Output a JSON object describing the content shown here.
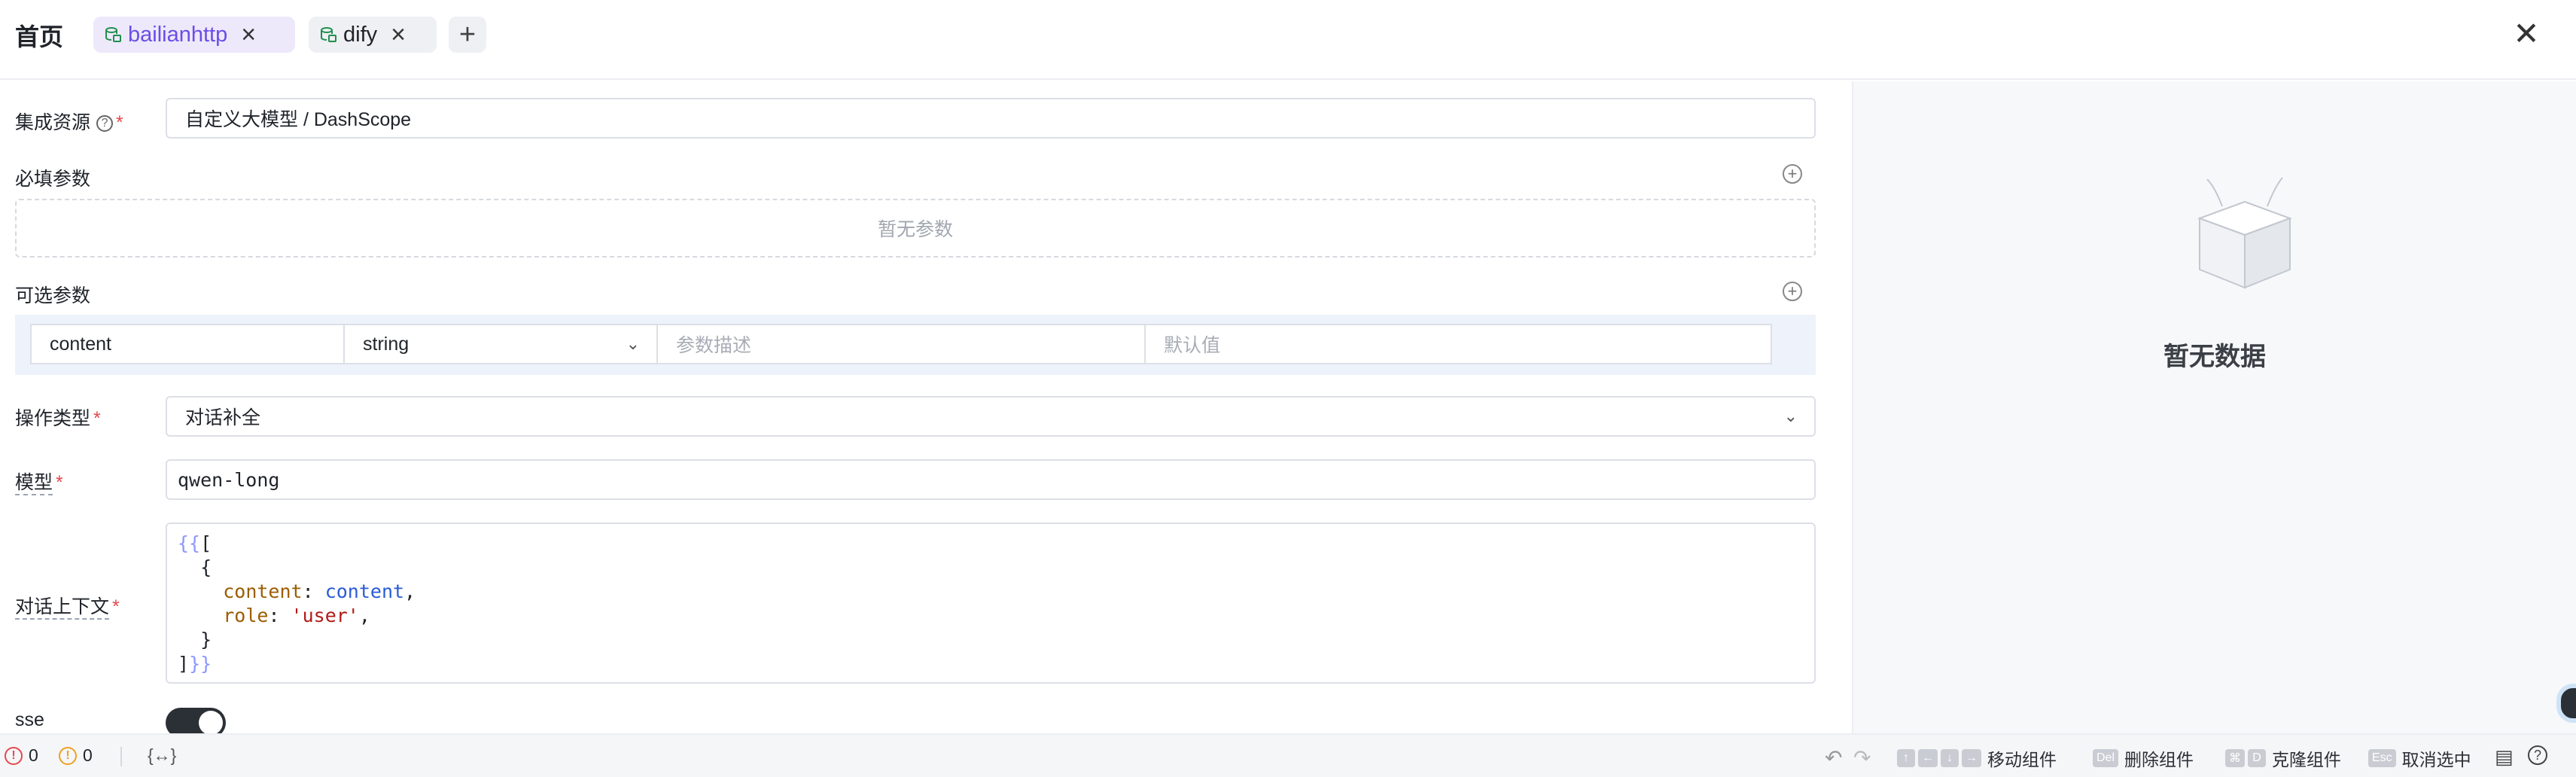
{
  "header": {
    "home_title": "首页",
    "tabs": [
      {
        "label": "bailianhttp",
        "icon": "database-icon",
        "color": "#6b4ee6"
      },
      {
        "label": "dify",
        "icon": "database-icon",
        "color": "#1f8f4e"
      }
    ],
    "add_tab_icon": "plus-icon",
    "close_icon": "close-icon"
  },
  "form": {
    "resource": {
      "label": "集成资源",
      "value": "自定义大模型 / DashScope",
      "required": "*"
    },
    "required_params": {
      "label": "必填参数",
      "empty_text": "暂无参数"
    },
    "optional_params": {
      "label": "可选参数",
      "rows": [
        {
          "name": "content",
          "type": "string",
          "desc_placeholder": "参数描述",
          "default_placeholder": "默认值"
        }
      ]
    },
    "operation_type": {
      "label": "操作类型",
      "value": "对话补全",
      "required": "*"
    },
    "model": {
      "label": "模型",
      "value": "qwen-long",
      "required": "*"
    },
    "context": {
      "label": "对话上下文",
      "required": "*",
      "code": {
        "open": "{{",
        "bracket_open": "[",
        "obj_open": "{",
        "key1": "content",
        "val1": "content",
        "key2": "role",
        "val2": "'user'",
        "obj_close": "}",
        "bracket_close": "]",
        "close": "}}"
      }
    },
    "sse": {
      "label": "sse",
      "enabled": true
    }
  },
  "right_panel": {
    "empty_text": "暂无数据"
  },
  "bottom_bar": {
    "errors": "0",
    "warnings": "0",
    "variable_icon": "{↔}",
    "shortcuts": [
      {
        "keys": [
          "↑",
          "←",
          "↓",
          "→"
        ],
        "label": "移动组件"
      },
      {
        "keys": [
          "Del"
        ],
        "label": "删除组件"
      },
      {
        "keys": [
          "⌘",
          "D"
        ],
        "label": "克隆组件"
      },
      {
        "keys": [
          "Esc"
        ],
        "label": "取消选中"
      }
    ]
  }
}
